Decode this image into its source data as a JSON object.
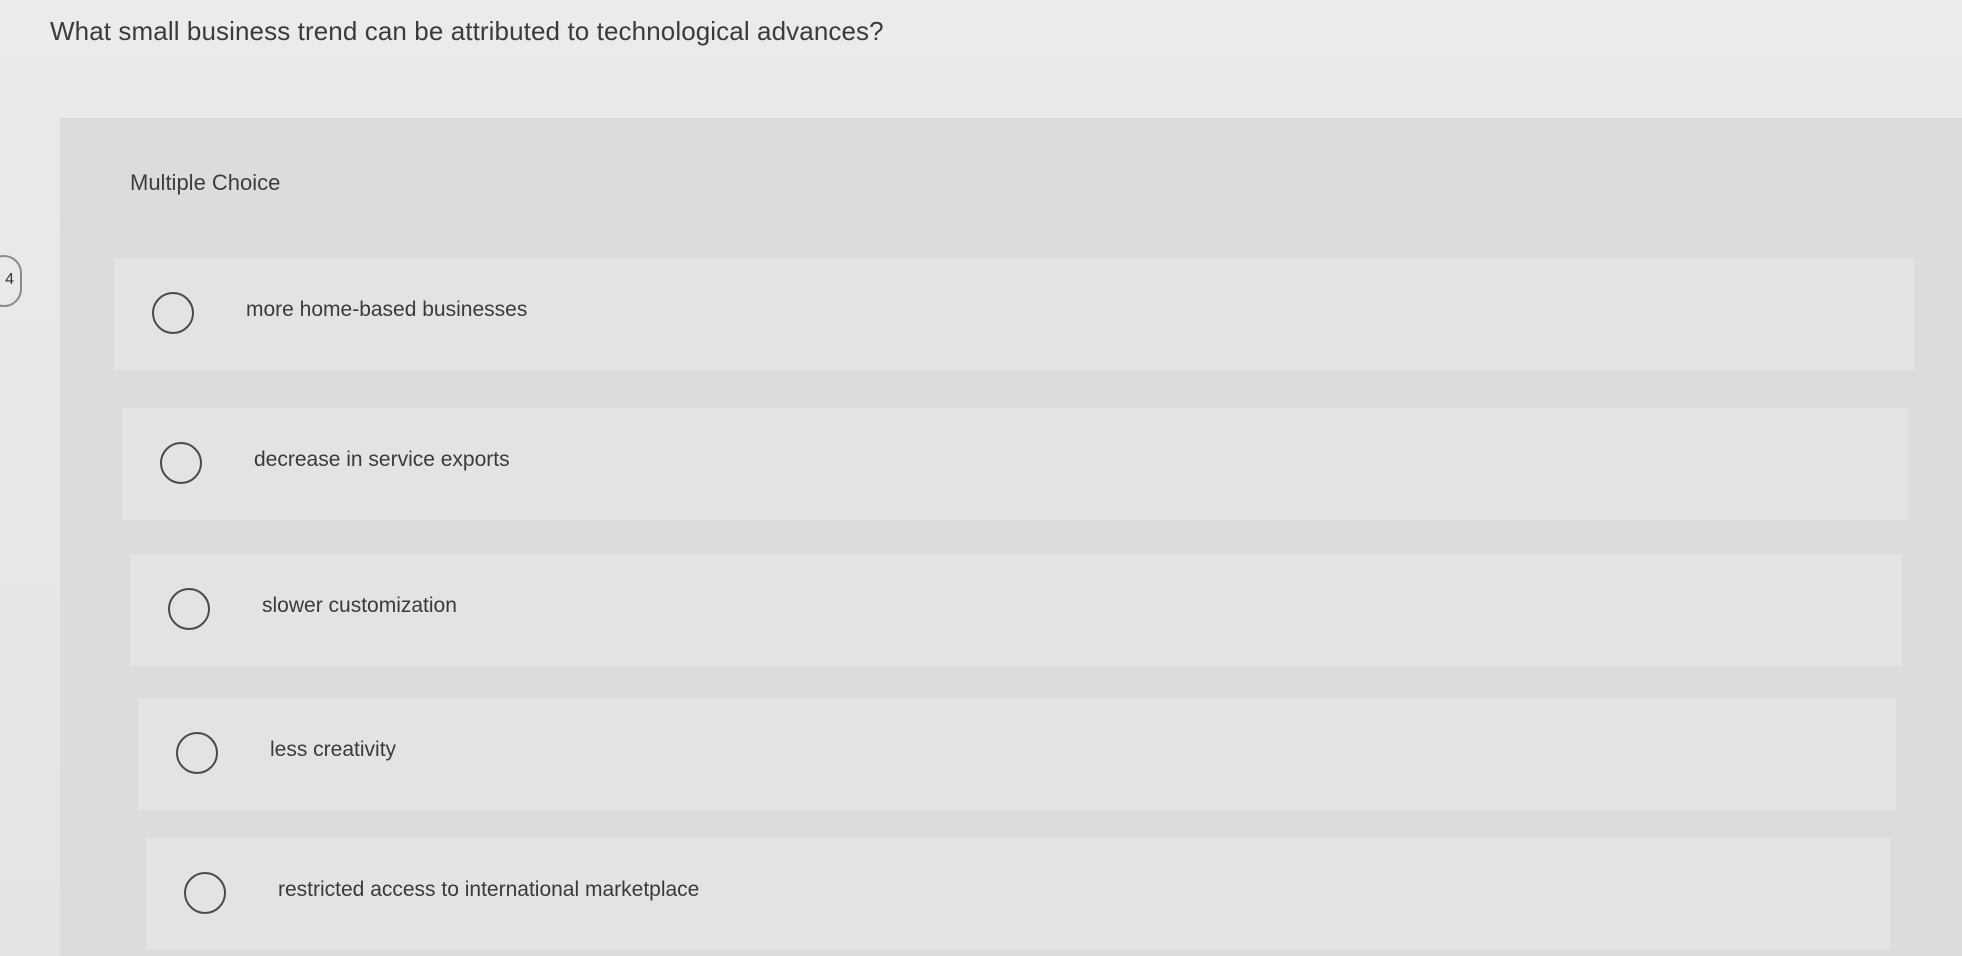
{
  "question": {
    "text": "What small business trend can be attributed to technological advances?"
  },
  "side_marker": {
    "text": "4"
  },
  "panel": {
    "label": "Multiple Choice"
  },
  "options": [
    {
      "label": "more home-based businesses"
    },
    {
      "label": "decrease in service exports"
    },
    {
      "label": "slower customization"
    },
    {
      "label": "less creativity"
    },
    {
      "label": "restricted access to international marketplace"
    }
  ],
  "colors": {
    "background": "#e6e6e4",
    "panel": "#dcdcda",
    "option": "#e3e3e1",
    "text": "#3a3a3a"
  }
}
